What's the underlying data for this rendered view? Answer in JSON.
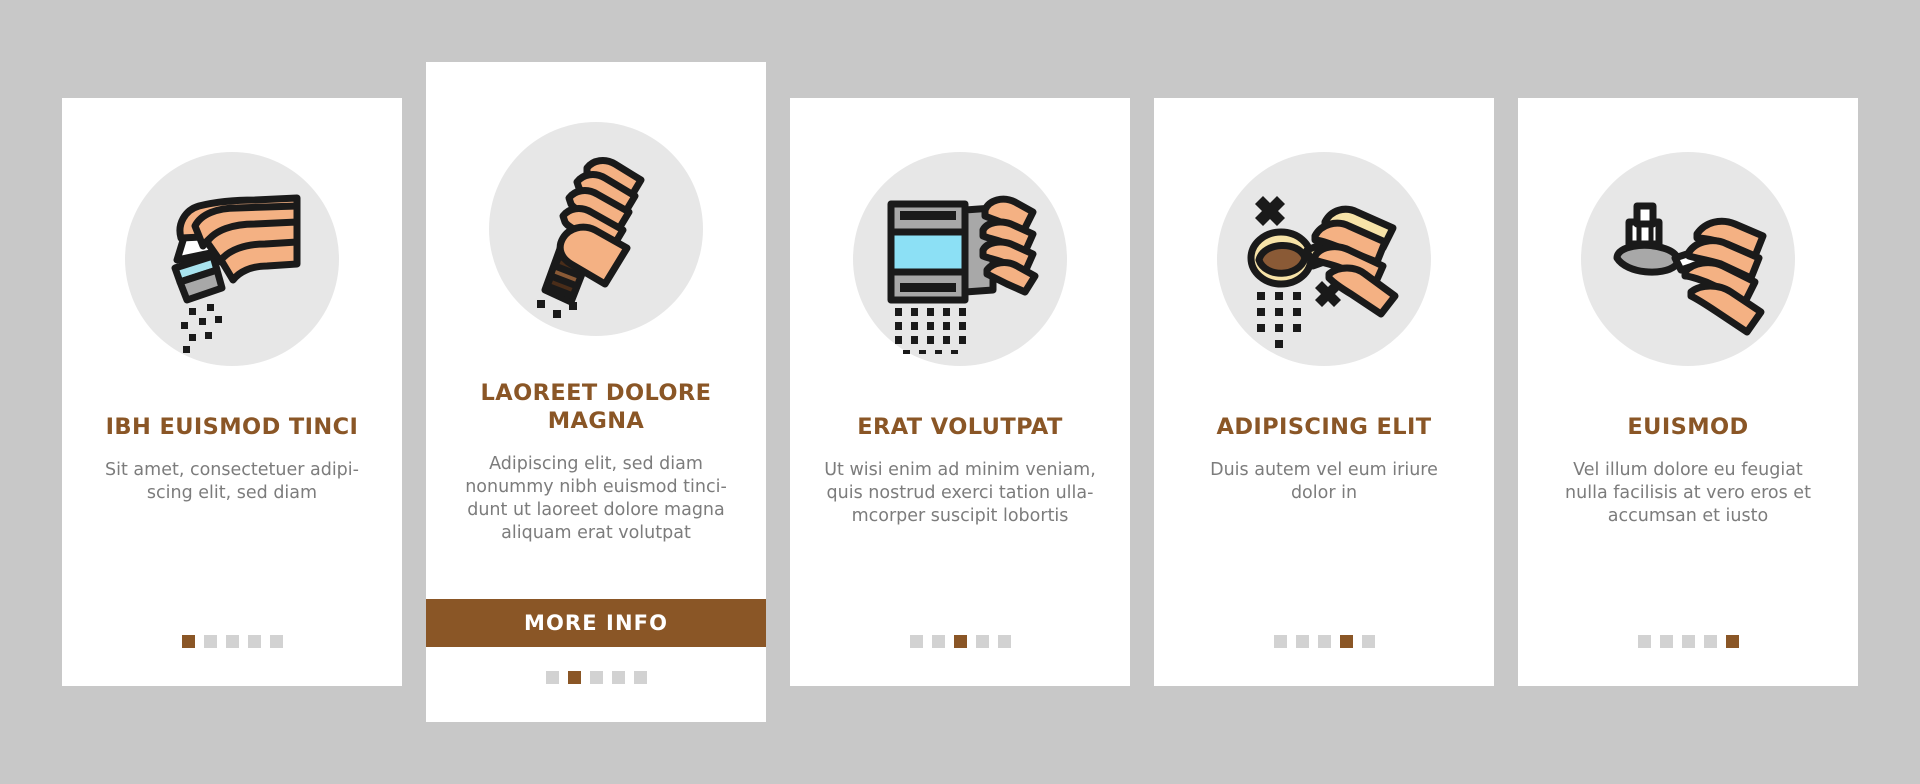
{
  "theme": {
    "page_background": "#c8c8c8",
    "card_background": "#ffffff",
    "icon_circle_background": "#e7e7e7",
    "title_color": "#8a5626",
    "body_color": "#7c7c7c",
    "accent_color": "#8a5626",
    "dot_inactive_color": "#d2d2d2",
    "skin_color": "#f4b183",
    "outline_color": "#1a1a1a"
  },
  "cards": [
    {
      "icon_name": "hand-salt-shaker-icon",
      "title": "IBH EUISMOD TINCI",
      "description": "Sit amet, consectetuer adipi-\nscing elit, sed diam",
      "dots_total": 5,
      "dot_active_index": 1,
      "featured": false,
      "cta_label": null
    },
    {
      "icon_name": "hands-pepper-grinder-icon",
      "title": "LAOREET DOLORE MAGNA",
      "description": "Adipiscing elit, sed diam\nnonummy nibh euismod tinci-\ndunt ut laoreet dolore magna\naliquam erat volutpat",
      "dots_total": 5,
      "dot_active_index": 2,
      "featured": true,
      "cta_label": "MORE INFO"
    },
    {
      "icon_name": "hand-spice-dispenser-icon",
      "title": "ERAT VOLUTPAT",
      "description": "Ut wisi enim ad minim veniam,\nquis nostrud exerci tation ulla-\nmcorper suscipit lobortis",
      "dots_total": 5,
      "dot_active_index": 3,
      "featured": false,
      "cta_label": null
    },
    {
      "icon_name": "hand-spoon-spice-sprinkle-icon",
      "title": "ADIPISCING ELIT",
      "description": "Duis autem vel eum iriure\ndolor in",
      "dots_total": 5,
      "dot_active_index": 4,
      "featured": false,
      "cta_label": null
    },
    {
      "icon_name": "hand-spoon-salt-crystal-icon",
      "title": "EUISMOD",
      "description": "Vel illum dolore eu feugiat\nnulla facilisis at vero eros et\naccumsan et iusto",
      "dots_total": 5,
      "dot_active_index": 5,
      "featured": false,
      "cta_label": null
    }
  ]
}
